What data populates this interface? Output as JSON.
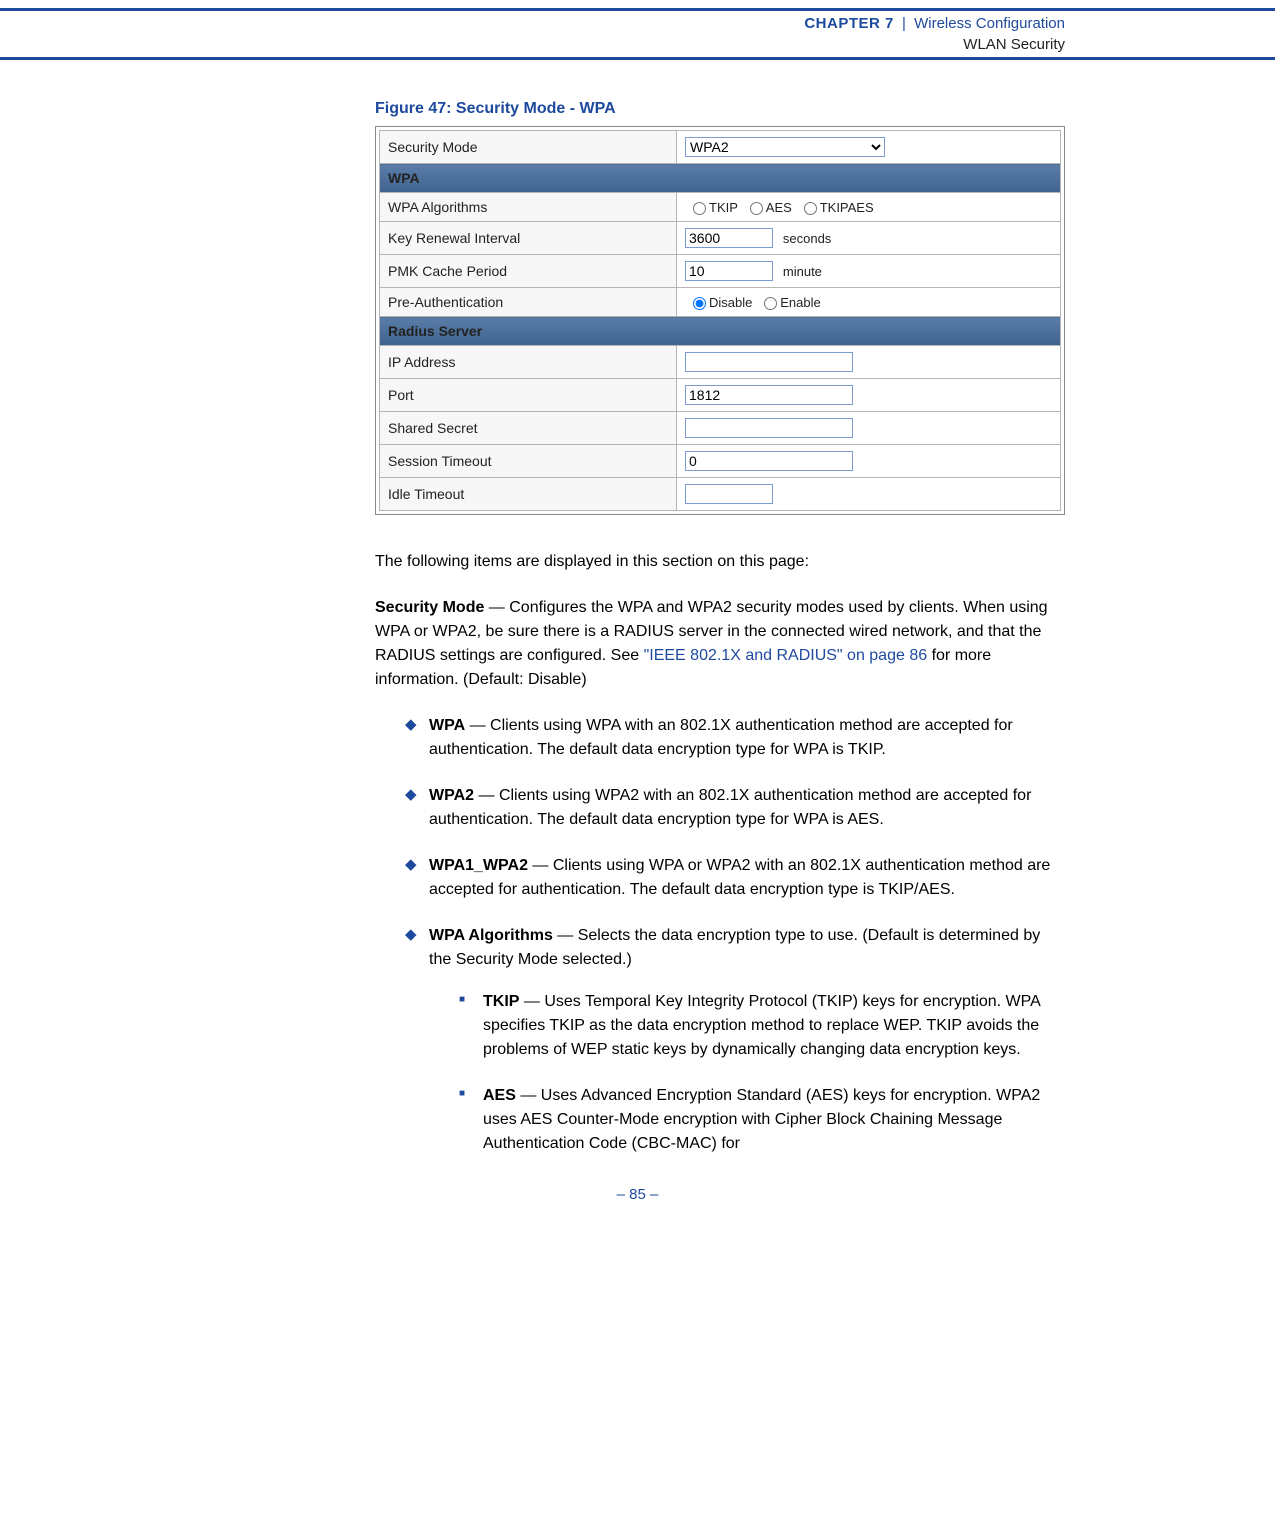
{
  "header": {
    "chapter": "CHAPTER 7",
    "pipe": "|",
    "section": "Wireless Configuration",
    "subsection": "WLAN Security"
  },
  "figure": {
    "caption": "Figure 47:  Security Mode - WPA",
    "security_mode_label": "Security Mode",
    "security_mode_value": "WPA2",
    "wpa_header": "WPA",
    "wpa_algorithms_label": "WPA Algorithms",
    "algo_tkip": "TKIP",
    "algo_aes": "AES",
    "algo_tkipaes": "TKIPAES",
    "key_renewal_label": "Key Renewal Interval",
    "key_renewal_value": "3600",
    "key_renewal_unit": "seconds",
    "pmk_label": "PMK Cache Period",
    "pmk_value": "10",
    "pmk_unit": "minute",
    "preauth_label": "Pre-Authentication",
    "preauth_disable": "Disable",
    "preauth_enable": "Enable",
    "radius_header": "Radius Server",
    "ip_label": "IP Address",
    "ip_value": "",
    "port_label": "Port",
    "port_value": "1812",
    "secret_label": "Shared Secret",
    "secret_value": "",
    "session_label": "Session Timeout",
    "session_value": "0",
    "idle_label": "Idle Timeout",
    "idle_value": ""
  },
  "intro": "The following items are displayed in this section on this page:",
  "secmode": {
    "term": "Security Mode",
    "text1": " — Configures the WPA and WPA2 security modes used by clients. When using WPA or WPA2, be sure there is a RADIUS server in the connected wired network, and that the RADIUS settings are configured. See ",
    "link": "\"IEEE 802.1X and RADIUS\" on page 86",
    "text2": " for more information. (Default: Disable)"
  },
  "items": {
    "wpa_term": "WPA",
    "wpa_text": " — Clients using WPA with an 802.1X authentication method are accepted for authentication. The default data encryption type for WPA is TKIP.",
    "wpa2_term": "WPA2",
    "wpa2_text": " — Clients using WPA2 with an 802.1X authentication method are accepted for authentication. The default data encryption type for WPA is AES.",
    "wpa12_term": "WPA1_WPA2",
    "wpa12_text": " — Clients using WPA or WPA2 with an 802.1X authentication method are accepted for authentication. The default data encryption type is TKIP/AES.",
    "algo_term": "WPA Algorithms",
    "algo_text": " — Selects the data encryption type to use. (Default is determined by the Security Mode selected.)",
    "tkip_term": "TKIP",
    "tkip_text": " — Uses Temporal Key Integrity Protocol (TKIP) keys for encryption. WPA specifies TKIP as the data encryption method to replace WEP. TKIP avoids the problems of WEP static keys by dynamically changing data encryption keys.",
    "aes_term": "AES",
    "aes_text": " — Uses Advanced Encryption Standard (AES) keys for encryption. WPA2 uses AES Counter-Mode encryption with Cipher Block Chaining Message Authentication Code (CBC-MAC) for"
  },
  "footer": "–  85  –"
}
